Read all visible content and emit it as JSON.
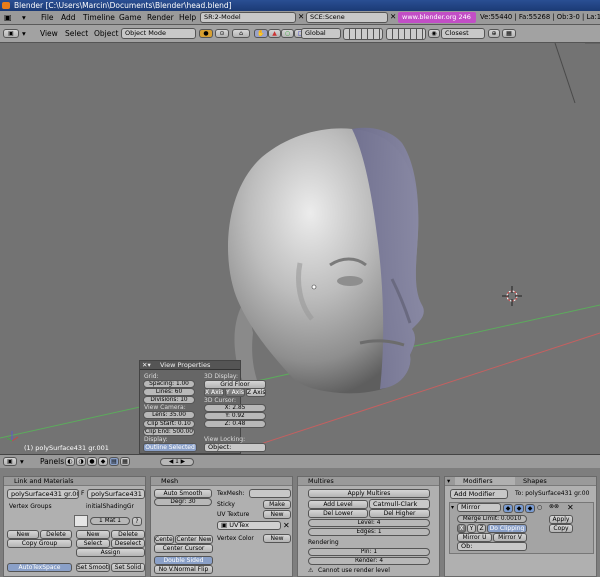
{
  "titlebar": {
    "title": "Blender [C:\\Users\\Marcin\\Documents\\Blender\\head.blend]"
  },
  "menubar": {
    "items": [
      "File",
      "Add",
      "Timeline",
      "Game",
      "Render",
      "Help"
    ],
    "screen": "SR:2-Model",
    "scene": "SCE:Scene",
    "website": "www.blender.org 246",
    "stats": "Ve:55440 | Fa:55268 | Ob:3-0 | La:1"
  },
  "toolbar": {
    "view": "View",
    "select": "Select",
    "object": "Object",
    "mode": "Object Mode",
    "orientation": "Global",
    "snap": "Closest"
  },
  "viewport": {
    "object_label": "(1) polySurface431 gr.001",
    "colors": {
      "bg": "#737373",
      "x_axis": "#c45a5a",
      "y_axis": "#5aa05a",
      "head_light": "#d8d8d8",
      "head_mid": "#9a9a9a",
      "head_selected": "#6a6a8a"
    }
  },
  "view_properties": {
    "title": "View Properties",
    "grid_label": "Grid:",
    "spacing": "Spacing: 1.00",
    "lines": "Lines: 60",
    "divisions": "Divisions: 10",
    "view_camera_label": "View Camera:",
    "lens": "Lens: 35.00",
    "clip_start": "Clip Start: 0.10",
    "clip_end": "Clip End: 500.00",
    "display_label": "Display:",
    "outline_selected": "Outline Selected",
    "display3d_label": "3D Display:",
    "grid_floor": "Grid Floor",
    "x_axis": "X Axis",
    "y_axis": "Y Axis",
    "z_axis": "Z Axis",
    "cursor_label": "3D Cursor:",
    "cx": "X: 2.85",
    "cy": "Y: 0.92",
    "cz": "Z: 0.48",
    "view_locking_label": "View Locking:",
    "object_label": "Object:"
  },
  "header3d": {
    "panels": "Panels",
    "page": "1"
  },
  "link_materials": {
    "title": "Link and Materials",
    "me_name": "polySurface431 gr.001",
    "f": "F",
    "ob_name": "polySurface431 gr.001",
    "vertex_groups": "Vertex Groups",
    "initial_shading": "initialShadingGr",
    "mat": "1 Mat 1",
    "q": "?",
    "new1": "New",
    "delete1": "Delete",
    "copy_group": "Copy Group",
    "new2": "New",
    "delete2": "Delete",
    "select": "Select",
    "deselect": "Deselect",
    "assign": "Assign",
    "autotexspace": "AutoTexSpace",
    "set_smooth": "Set Smooth",
    "set_solid": "Set Solid"
  },
  "mesh": {
    "title": "Mesh",
    "auto_smooth": "Auto Smooth",
    "degr": "Degr: 30",
    "texmesh": "TexMesh:",
    "sticky": "Sticky",
    "make": "Make",
    "uv_texture": "UV Texture",
    "new_uv": "New",
    "uvtex": "UVTex",
    "center": "Center",
    "center_new": "Center New",
    "center_cursor": "Center Cursor",
    "double_sided": "Double Sided",
    "no_vnormal_flip": "No V.Normal Flip",
    "vertex_color": "Vertex Color",
    "new_vc": "New"
  },
  "multires": {
    "title": "Multires",
    "apply_multires": "Apply Multires",
    "add_level": "Add Level",
    "catmull": "Catmull-Clark",
    "del_lower": "Del Lower",
    "del_higher": "Del Higher",
    "level": "Level: 4",
    "edges": "Edges: 1",
    "rendering": "Rendering",
    "pin": "Pin: 1",
    "render": "Render: 4",
    "warning": "Cannot use render level"
  },
  "modifiers": {
    "tab_modifiers": "Modifiers",
    "tab_shapes": "Shapes",
    "add_modifier": "Add Modifier",
    "to_label": "To: polySurface431 gr.00",
    "mirror": "Mirror",
    "merge_limit": "Merge Limit: 0.0010",
    "x": "X",
    "y": "Y",
    "z": "Z",
    "do_clipping": "Do Clipping",
    "mirror_u": "Mirror U",
    "mirror_v": "Mirror V",
    "ob": "Ob:",
    "apply": "Apply",
    "copy": "Copy"
  }
}
